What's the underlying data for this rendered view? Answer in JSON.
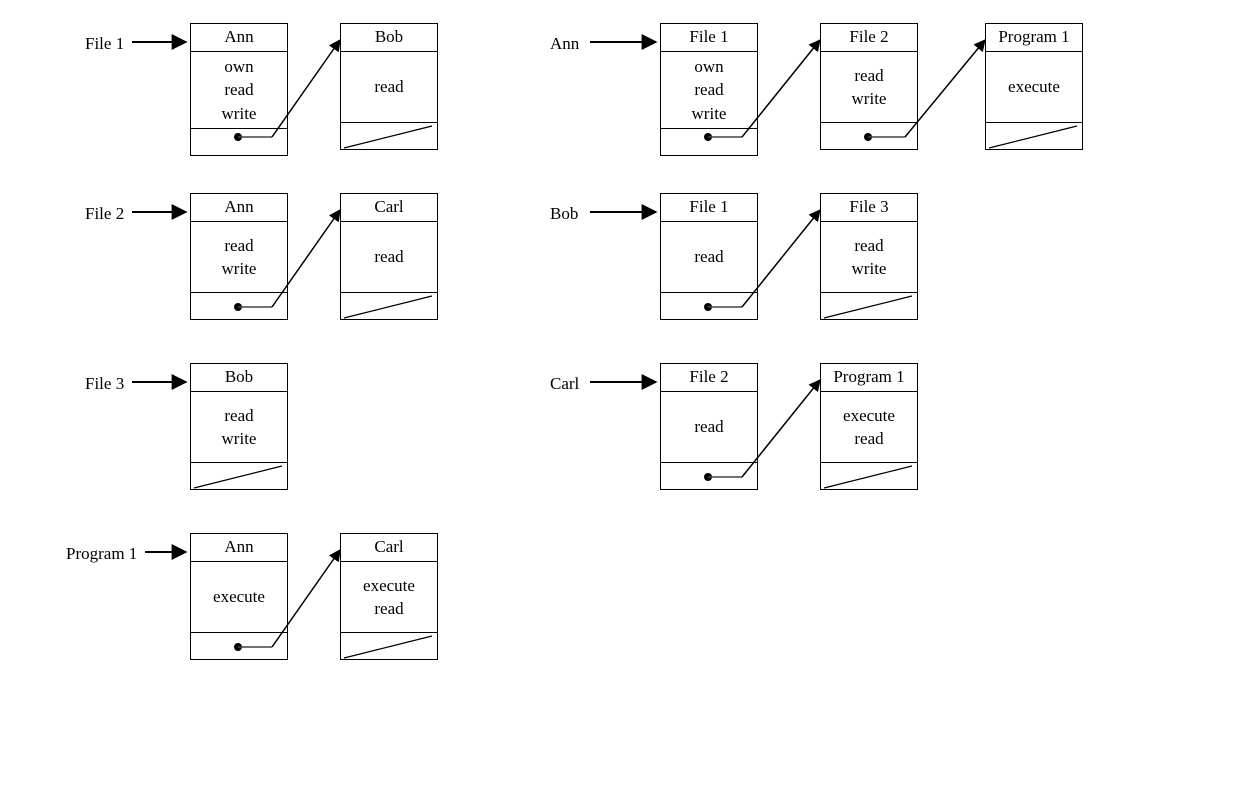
{
  "left": {
    "rows": [
      {
        "label": "File 1",
        "chain": [
          {
            "title": "Ann",
            "perms": [
              "own",
              "read",
              "write"
            ],
            "next": true
          },
          {
            "title": "Bob",
            "perms": [
              "read"
            ],
            "next": false
          }
        ]
      },
      {
        "label": "File 2",
        "chain": [
          {
            "title": "Ann",
            "perms": [
              "read",
              "write"
            ],
            "next": true
          },
          {
            "title": "Carl",
            "perms": [
              "read"
            ],
            "next": false
          }
        ]
      },
      {
        "label": "File 3",
        "chain": [
          {
            "title": "Bob",
            "perms": [
              "read",
              "write"
            ],
            "next": false
          }
        ]
      },
      {
        "label": "Program 1",
        "chain": [
          {
            "title": "Ann",
            "perms": [
              "execute"
            ],
            "next": true
          },
          {
            "title": "Carl",
            "perms": [
              "execute",
              "read"
            ],
            "next": false
          }
        ]
      }
    ]
  },
  "right": {
    "rows": [
      {
        "label": "Ann",
        "chain": [
          {
            "title": "File 1",
            "perms": [
              "own",
              "read",
              "write"
            ],
            "next": true
          },
          {
            "title": "File 2",
            "perms": [
              "read",
              "write"
            ],
            "next": true
          },
          {
            "title": "Program 1",
            "perms": [
              "execute"
            ],
            "next": false
          }
        ]
      },
      {
        "label": "Bob",
        "chain": [
          {
            "title": "File 1",
            "perms": [
              "read"
            ],
            "next": true
          },
          {
            "title": "File 3",
            "perms": [
              "read",
              "write"
            ],
            "next": false
          }
        ]
      },
      {
        "label": "Carl",
        "chain": [
          {
            "title": "File 2",
            "perms": [
              "read"
            ],
            "next": true
          },
          {
            "title": "Program 1",
            "perms": [
              "execute",
              "read"
            ],
            "next": false
          }
        ]
      }
    ]
  }
}
